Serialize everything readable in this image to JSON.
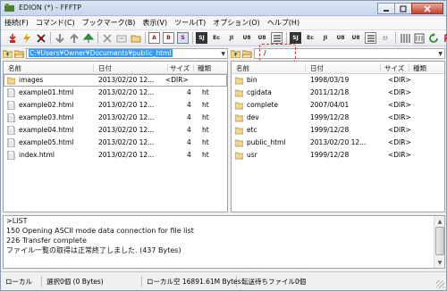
{
  "window": {
    "title": "EDION (*) - FFFTP"
  },
  "menu": [
    "接続(F)",
    "コマンド(C)",
    "ブックマーク(B)",
    "表示(V)",
    "ツール(T)",
    "オプション(O)",
    "ヘルプ(H)"
  ],
  "toolbar": {
    "ascii_label": "A",
    "binary_label": "B",
    "auto_label": "S",
    "kanji_sjis": "SJ",
    "kanji_euc": "Ec",
    "kanji_jis": "JI",
    "kanji_utf8": "U8",
    "kanji_utf8n": "U8",
    "kana_label": "ｶﾅ",
    "remote_sjis": "SJ",
    "remote_euc": "Ec",
    "remote_jis": "JI",
    "remote_utf8": "U8",
    "remote_utf8n": "U8"
  },
  "local": {
    "path": "C:¥Users¥Owner¥Documents¥public_html",
    "columns": {
      "name": "名前",
      "date": "日付",
      "size": "サイズ",
      "type": "種類"
    },
    "files": [
      {
        "name": "images",
        "date": "2013/02/20 12...",
        "size": "<DIR>",
        "type": "",
        "kind": "folder"
      },
      {
        "name": "example01.html",
        "date": "2013/02/20 12...",
        "size": "4",
        "type": "ht",
        "kind": "file"
      },
      {
        "name": "example02.html",
        "date": "2013/02/20 12...",
        "size": "4",
        "type": "ht",
        "kind": "file"
      },
      {
        "name": "example03.html",
        "date": "2013/02/20 12...",
        "size": "4",
        "type": "ht",
        "kind": "file"
      },
      {
        "name": "example04.html",
        "date": "2013/02/20 12...",
        "size": "4",
        "type": "ht",
        "kind": "file"
      },
      {
        "name": "example05.html",
        "date": "2013/02/20 12...",
        "size": "4",
        "type": "ht",
        "kind": "file"
      },
      {
        "name": "index.html",
        "date": "2013/02/20 12...",
        "size": "4",
        "type": "ht",
        "kind": "file"
      }
    ]
  },
  "remote": {
    "path": "/",
    "columns": {
      "name": "名前",
      "date": "日付",
      "size": "サイズ",
      "type": "種類"
    },
    "files": [
      {
        "name": "bin",
        "date": "1998/03/19",
        "size": "<DIR>"
      },
      {
        "name": "cgidata",
        "date": "2011/12/18",
        "size": "<DIR>"
      },
      {
        "name": "complete",
        "date": "2007/04/01",
        "size": "<DIR>"
      },
      {
        "name": "dev",
        "date": "1999/12/28",
        "size": "<DIR>"
      },
      {
        "name": "etc",
        "date": "1999/12/28",
        "size": "<DIR>"
      },
      {
        "name": "public_html",
        "date": "2013/02/20 12...",
        "size": "<DIR>"
      },
      {
        "name": "usr",
        "date": "1999/12/28",
        "size": "<DIR>"
      }
    ]
  },
  "log": [
    ">LIST",
    "150 Opening ASCII mode data connection for file list",
    "226 Transfer complete",
    "ファイル一覧の取得は正常終了しました. (437 Bytes)"
  ],
  "status": {
    "mode": "ローカル",
    "selection": "選択0個 (0 Bytes)",
    "free_space": "ローカル空 16891.61M Bytes",
    "queue": "転送待ちファイル0個"
  },
  "colors": {
    "selection": "#3399ff",
    "folder": "#f0c040",
    "close_button": "#c7422e"
  }
}
